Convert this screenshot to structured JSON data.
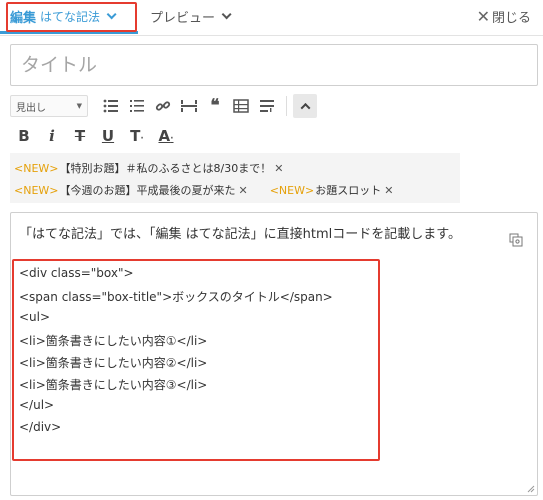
{
  "tabs": {
    "edit_main": "編集",
    "edit_sub": "はてな記法",
    "preview": "プレビュー",
    "close": "閉じる"
  },
  "title": {
    "placeholder": "タイトル"
  },
  "toolbar": {
    "heading_select": "見出し",
    "row1_icons": [
      "bulleted-list-icon",
      "numbered-list-icon",
      "link-icon",
      "horizontal-rule-icon",
      "quote-icon",
      "table-icon",
      "more-icon",
      "collapse-up-icon"
    ],
    "row2": {
      "bold": "B",
      "italic": "i",
      "strike": "T",
      "underline": "U",
      "size": "T",
      "color": "A"
    }
  },
  "topics": [
    {
      "tag": "<NEW>",
      "text": "【特別お題】＃私のふるさとは8/30まで！"
    },
    {
      "tag": "<NEW>",
      "text": "【今週のお題】平成最後の夏が来た"
    },
    {
      "tag": "<NEW>",
      "text": "お題スロット"
    }
  ],
  "editor": {
    "intro": "「はてな記法」では、「編集 はてな記法」に直接htmlコードを記載します。",
    "code_lines": [
      "<div class=\"box\">",
      "<span class=\"box-title\">ボックスのタイトル</span>",
      "<ul>",
      "<li>箇条書きにしたい内容①</li>",
      "<li>箇条書きにしたい内容②</li>",
      "<li>箇条書きにしたい内容③</li>",
      "</ul>",
      "</div>"
    ]
  },
  "colors": {
    "accent": "#3a9bd6",
    "highlight_red": "#e53b2f",
    "new_tag": "#e5a10b"
  }
}
